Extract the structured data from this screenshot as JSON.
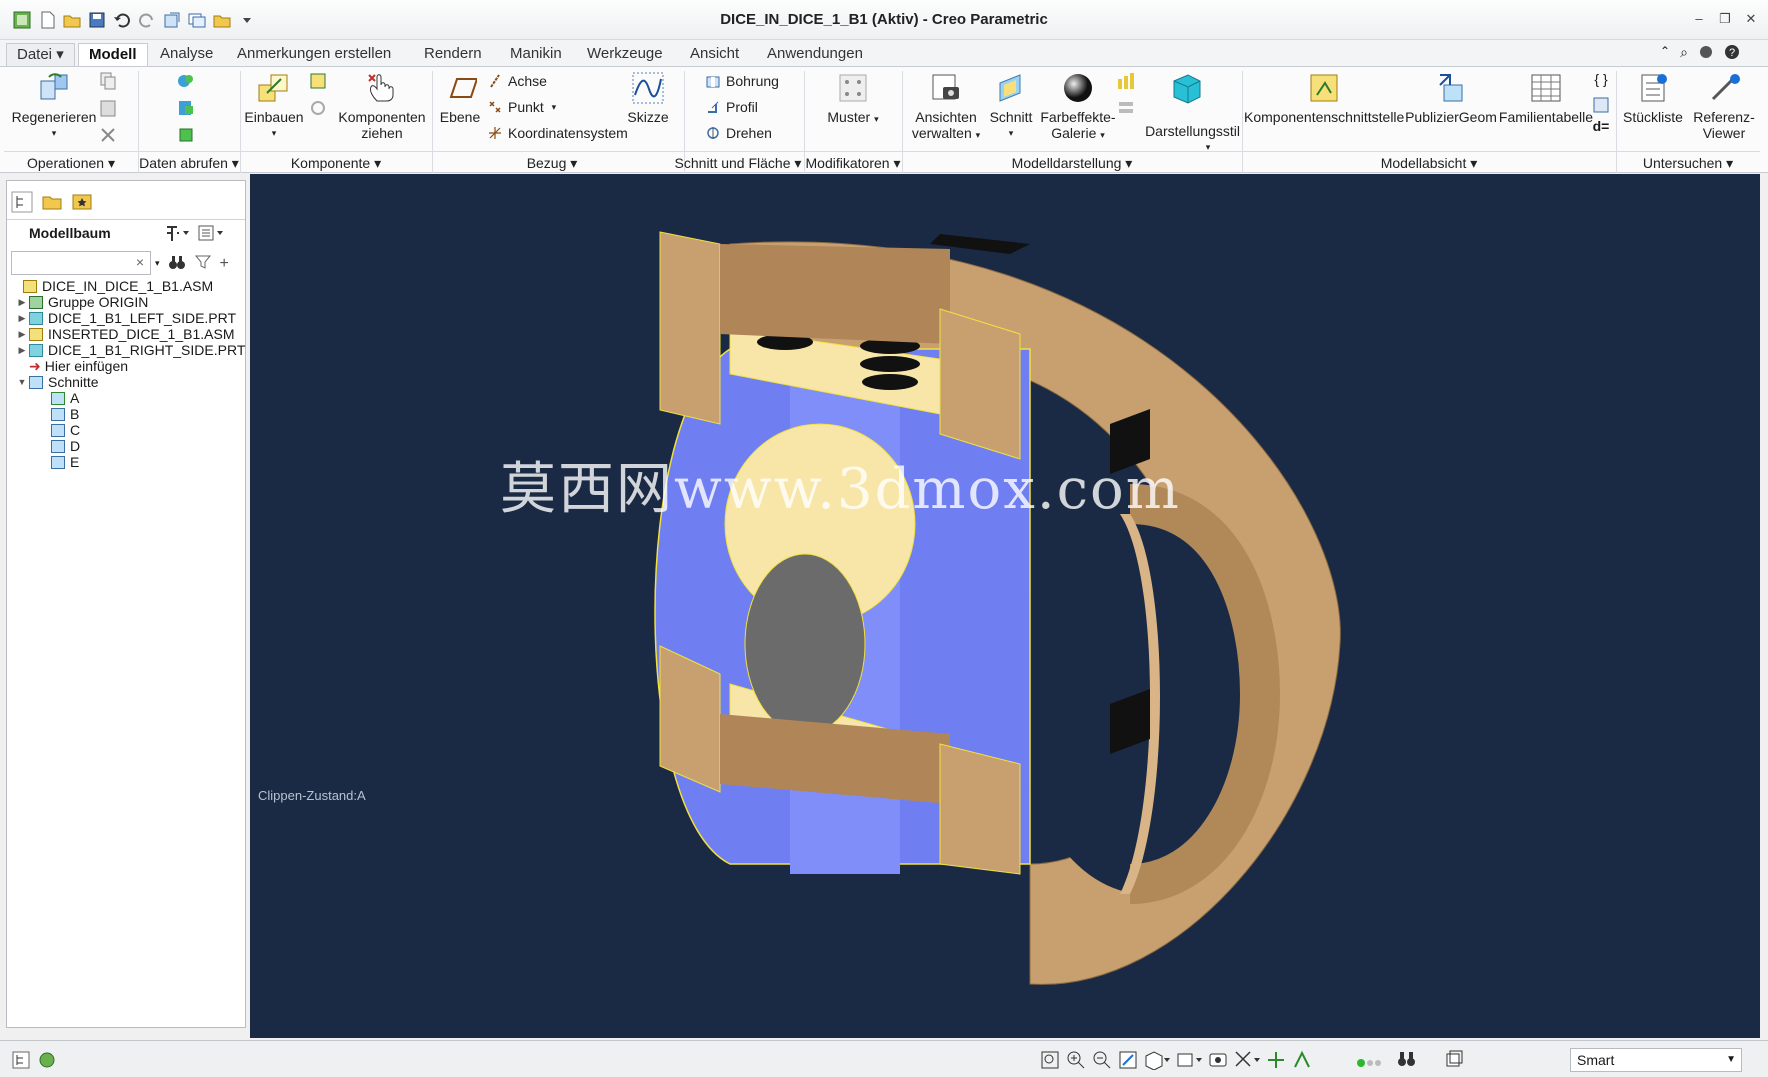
{
  "window": {
    "title": "DICE_IN_DICE_1_B1 (Aktiv) - Creo Parametric",
    "minimize": "–",
    "restore": "❐",
    "close": "✕"
  },
  "tabs": [
    "Datei",
    "Modell",
    "Analyse",
    "Anmerkungen erstellen",
    "Rendern",
    "Manikin",
    "Werkzeuge",
    "Ansicht",
    "Anwendungen"
  ],
  "ribbon": {
    "regenerieren": "Regenerieren",
    "einbauen": "Einbauen",
    "komponenten_1": "Komponenten",
    "komponenten_2": "ziehen",
    "ebene": "Ebene",
    "achse": "Achse",
    "punkt": "Punkt",
    "koordinatensystem": "Koordinatensystem",
    "skizze": "Skizze",
    "bohrung": "Bohrung",
    "profil": "Profil",
    "drehen": "Drehen",
    "muster": "Muster",
    "ansichten_1": "Ansichten",
    "ansichten_2": "verwalten",
    "schnitt": "Schnitt",
    "farbeffekte_1": "Farbeffekte-",
    "farbeffekte_2": "Galerie",
    "darstellungsstil": "Darstellungsstil",
    "komponentenschnittstelle": "Komponentenschnittstelle",
    "publiziergeom": "PublizierGeom",
    "familientabelle": "Familientabelle",
    "stueckliste": "Stückliste",
    "referenz_1": "Referenz-",
    "referenz_2": "Viewer",
    "d_equals": "d="
  },
  "groups": [
    "Operationen",
    "Daten abrufen",
    "Komponente",
    "Bezug",
    "Schnitt und Fläche",
    "Modifikatoren",
    "Modelldarstellung",
    "Modellabsicht",
    "Untersuchen"
  ],
  "tree": {
    "title": "Modellbaum",
    "search_clear": "×",
    "items": [
      {
        "label": "DICE_IN_DICE_1_B1.ASM",
        "twisty": ""
      },
      {
        "label": "Gruppe ORIGIN",
        "twisty": "▶"
      },
      {
        "label": "DICE_1_B1_LEFT_SIDE.PRT",
        "twisty": "▶"
      },
      {
        "label": "INSERTED_DICE_1_B1.ASM",
        "twisty": "▶"
      },
      {
        "label": "DICE_1_B1_RIGHT_SIDE.PRT",
        "twisty": "▶"
      },
      {
        "label": "Hier einfügen",
        "twisty": ""
      },
      {
        "label": "Schnitte",
        "twisty": "▼"
      },
      {
        "label": "A",
        "twisty": ""
      },
      {
        "label": "B",
        "twisty": ""
      },
      {
        "label": "C",
        "twisty": ""
      },
      {
        "label": "D",
        "twisty": ""
      },
      {
        "label": "E",
        "twisty": ""
      }
    ]
  },
  "viewport": {
    "clip_state": "Clippen-Zustand:A",
    "watermark": "莫西网www.3dmox.com"
  },
  "status": {
    "filter_value": "Smart"
  },
  "colors": {
    "viewport_bg": "#1a2a44",
    "part_tan": "#c8a070",
    "section_blue": "#6f7ff2",
    "cap_yellow": "#f7e6a8",
    "highlight": "#f0e040"
  }
}
